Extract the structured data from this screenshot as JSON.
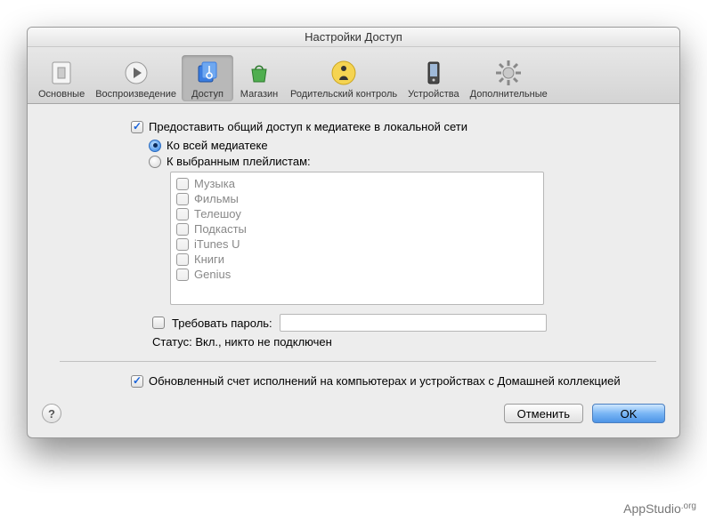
{
  "window": {
    "title": "Настройки Доступ"
  },
  "toolbar": {
    "items": [
      {
        "key": "general",
        "label": "Основные"
      },
      {
        "key": "playback",
        "label": "Воспроизведение"
      },
      {
        "key": "sharing",
        "label": "Доступ"
      },
      {
        "key": "store",
        "label": "Магазин"
      },
      {
        "key": "parental",
        "label": "Родительский контроль"
      },
      {
        "key": "devices",
        "label": "Устройства"
      },
      {
        "key": "advanced",
        "label": "Дополнительные"
      }
    ],
    "selected": "sharing"
  },
  "sharing": {
    "share_library_label": "Предоставить общий доступ к медиатеке в локальной сети",
    "share_library_checked": true,
    "radio_all_label": "Ко всей медиатеке",
    "radio_selected_label": "К выбранным плейлистам:",
    "playlists": [
      "Музыка",
      "Фильмы",
      "Телешоу",
      "Подкасты",
      "iTunes U",
      "Книги",
      "Genius"
    ],
    "require_password_label": "Требовать пароль:",
    "require_password_checked": false,
    "password_value": "",
    "status_prefix": "Статус: ",
    "status_value": "Вкл., никто не подключен",
    "home_sharing_label": "Обновленный счет исполнений на компьютерах и устройствах с Домашней коллекцией",
    "home_sharing_checked": true
  },
  "footer": {
    "cancel": "Отменить",
    "ok": "OK"
  },
  "watermark": {
    "text": "AppStudio",
    "domain": ".org"
  }
}
